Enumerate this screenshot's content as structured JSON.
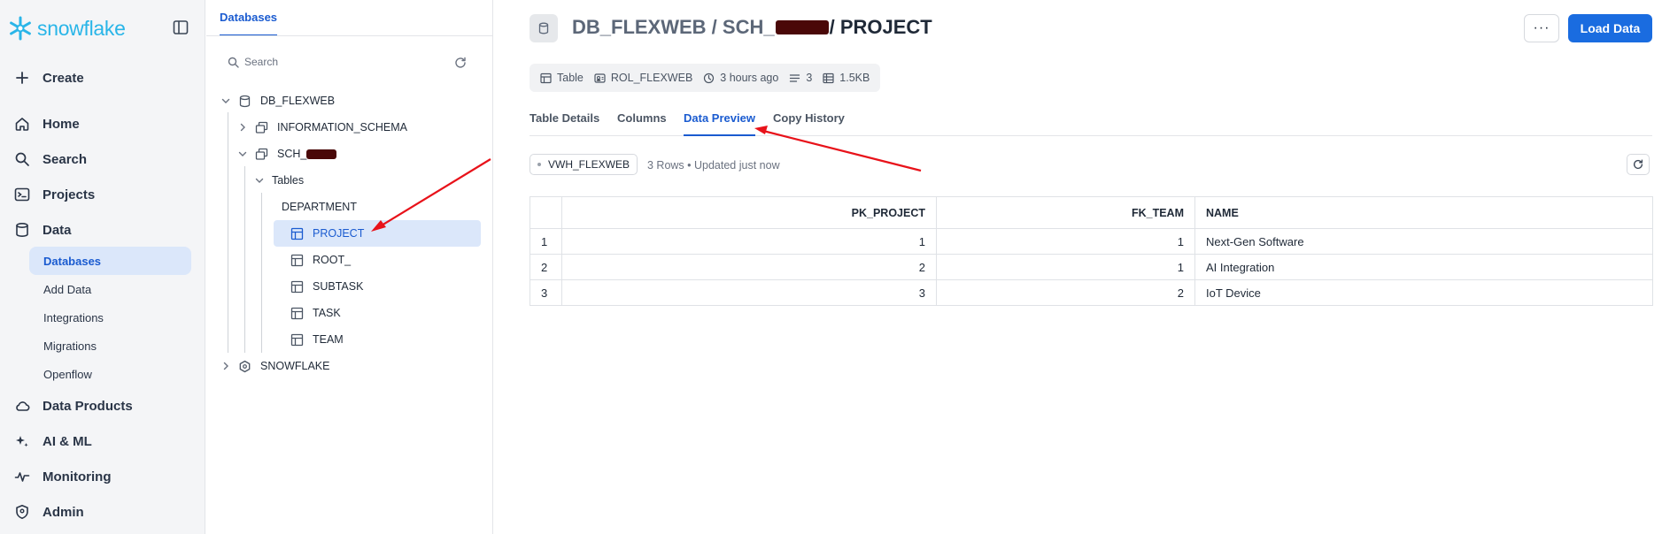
{
  "brand": {
    "name": "snowflake",
    "color": "#29b5e8"
  },
  "nav": {
    "create": "Create",
    "items": [
      {
        "label": "Home",
        "icon": "home-icon"
      },
      {
        "label": "Search",
        "icon": "search-icon"
      },
      {
        "label": "Projects",
        "icon": "terminal-icon"
      },
      {
        "label": "Data",
        "icon": "database-icon"
      }
    ],
    "data_sub": [
      "Databases",
      "Add Data",
      "Integrations",
      "Migrations",
      "Openflow"
    ],
    "items_bottom": [
      {
        "label": "Data Products",
        "icon": "cloud-icon"
      },
      {
        "label": "AI & ML",
        "icon": "sparkle-icon"
      },
      {
        "label": "Monitoring",
        "icon": "activity-icon"
      },
      {
        "label": "Admin",
        "icon": "shield-icon"
      }
    ]
  },
  "browser": {
    "tab": "Databases",
    "search_placeholder": "Search",
    "tree": {
      "db": "DB_FLEXWEB",
      "info_schema": "INFORMATION_SCHEMA",
      "schema": "SCH_",
      "tables_folder": "Tables",
      "tables": [
        "DEPARTMENT",
        "PROJECT",
        "ROOT_",
        "SUBTASK",
        "TASK",
        "TEAM"
      ],
      "snowflake_db": "SNOWFLAKE"
    }
  },
  "header": {
    "title_db": "DB_FLEXWEB / SCH_",
    "title_table": "/ PROJECT",
    "more_label": "···",
    "load_label": "Load Data"
  },
  "meta": {
    "type": "Table",
    "role": "ROL_FLEXWEB",
    "updated": "3 hours ago",
    "rows": "3",
    "size": "1.5KB"
  },
  "tabs": [
    "Table Details",
    "Columns",
    "Data Preview",
    "Copy History"
  ],
  "preview": {
    "warehouse": "VWH_FLEXWEB",
    "info": "3 Rows • Updated just now",
    "columns": [
      "PK_PROJECT",
      "FK_TEAM",
      "NAME"
    ],
    "rows": [
      [
        "1",
        "1",
        "1",
        "Next-Gen Software"
      ],
      [
        "2",
        "2",
        "1",
        "AI Integration"
      ],
      [
        "3",
        "3",
        "2",
        "IoT Device"
      ]
    ]
  },
  "colors": {
    "accent": "#1a6ce0",
    "selected_bg": "#dbe7fa",
    "annotation": "#e8121a"
  }
}
